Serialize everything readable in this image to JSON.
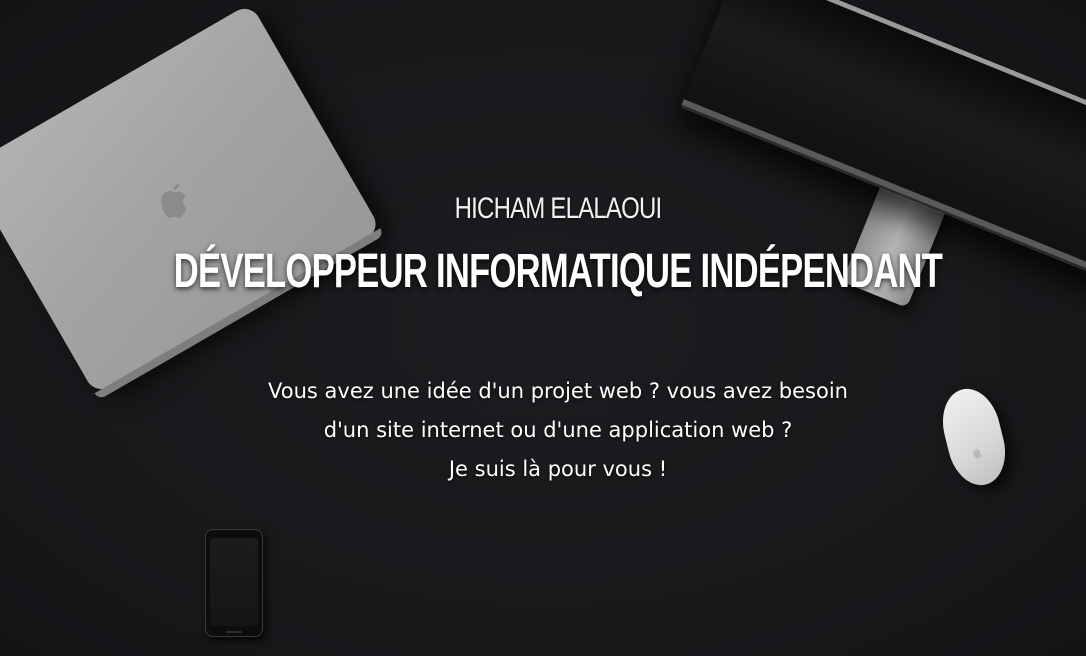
{
  "hero": {
    "name": "HICHAM ELALAOUI",
    "title": "DÉVELOPPEUR INFORMATIQUE INDÉPENDANT",
    "description": [
      "Vous avez une idée d'un projet web ? vous avez besoin",
      "d'un site internet ou d'une application web ?",
      "Je suis là pour vous !"
    ]
  },
  "colors": {
    "background": "#19181b",
    "text": "#ffffff"
  },
  "icons": [
    "apple-logo-icon"
  ]
}
